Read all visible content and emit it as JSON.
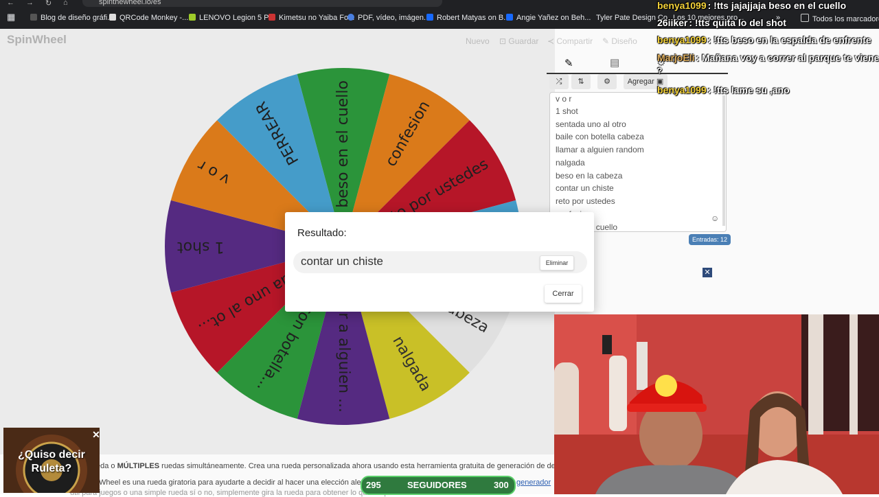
{
  "browser": {
    "url": "spinthewheel.io/es",
    "bookmarks": [
      "Blog de diseño gráfi...",
      "QRCode Monkey -...",
      "LENOVO Legion 5 P...",
      "Kimetsu no Yaiba Fo...",
      "PDF, vídeo, imágen...",
      "Robert Matyas on B...",
      "Angie Yañez on Beh...",
      "Tyler Pate Design Co",
      "Los 10 mejores pro...",
      "Todos los marcadores"
    ]
  },
  "site": {
    "logo": "SpinWheel",
    "menu": [
      "Nuevo",
      "Guardar",
      "Compartir",
      "Diseño"
    ]
  },
  "wheel": {
    "segments": [
      {
        "label": "beso en el cuello",
        "color": "#2e9e3e"
      },
      {
        "label": "confesion",
        "color": "#e8821c"
      },
      {
        "label": "reto por ustedes",
        "color": "#c2182b"
      },
      {
        "label": "contar un chiste",
        "color": "#4aa6d6"
      },
      {
        "label": "beso en la cabeza",
        "color": "#eeeeee"
      },
      {
        "label": "nalgada",
        "color": "#d6cc2a"
      },
      {
        "label": "llamar a alguien ...",
        "color": "#5b2d8a"
      },
      {
        "label": "baile con botella...",
        "color": "#2e9e3e"
      },
      {
        "label": "sentada uno al ot...",
        "color": "#c2182b"
      },
      {
        "label": "1 shot",
        "color": "#5b2d8a"
      },
      {
        "label": "v o r",
        "color": "#e8821c"
      },
      {
        "label": "PERREAR",
        "color": "#4aa6d6"
      }
    ]
  },
  "panel": {
    "add_label": "Agregar",
    "entries": [
      "v o r",
      "1 shot",
      "sentada uno al otro",
      "baile con botella cabeza",
      "llamar a alguien random",
      "nalgada",
      "beso en la cabeza",
      "contar un chiste",
      "reto por ustedes",
      "confesion",
      "beso en el cuello"
    ],
    "count": "Entradas: 12"
  },
  "dialog": {
    "title": "Resultado:",
    "result": "contar un chiste",
    "delete_label": "Eliminar",
    "close_label": "Cerrar"
  },
  "chat": [
    {
      "user": "benya1099",
      "user_color": "#f5d33a",
      "text": ": !tts jajajjaja beso en el cuello"
    },
    {
      "user": "26iiker",
      "user_color": "#ffffff",
      "text": ": !tts quita lo del shot"
    },
    {
      "user": "benya1099",
      "user_color": "#f5d33a",
      "text": ": !tts beso en la espalda de enfrente"
    },
    {
      "user": "MarjoEli",
      "user_color": "#e0b060",
      "text": ": Mañana voy a correr al parque te viene"
    },
    {
      "user": "",
      "user_color": "#ffffff",
      "text": "?"
    },
    {
      "user": "benya1099",
      "user_color": "#f5d33a",
      "text": ": !tts lame su ,ano"
    }
  ],
  "page_text": {
    "line1_pre": "eda o ",
    "line1_bold": "MÚLTIPLES",
    "line1_post": " ruedas simultáneamente. Crea una rueda personalizada ahora usando esta herramienta gratuita de generación de decisiones",
    "line2": "Wheel es una rueda giratoria para ayudarte a decidir al hacer una elección aleatoria",
    "line2_link": "generador",
    "line3": "útil para juegos o una simple rueda sí o no, simplemente gira la rueda para obtener lo que tú quieres"
  },
  "ad": {
    "text": "¿Quiso decir Ruleta?"
  },
  "followers": {
    "current": "295",
    "label": "SEGUIDORES",
    "goal": "300"
  }
}
